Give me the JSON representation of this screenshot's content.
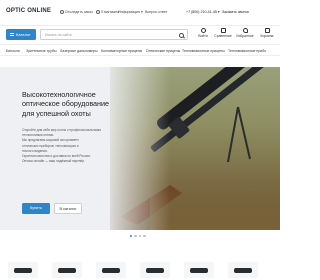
{
  "topbar": {
    "logo": "OPTIC ONLINE",
    "links": [
      {
        "label": "Отследить заказ",
        "icon": "truck-icon"
      },
      {
        "label": "3 магазина",
        "icon": "location-icon"
      },
      {
        "label": "Информация ▾",
        "icon": ""
      },
      {
        "label": "Вопрос-ответ",
        "icon": ""
      }
    ],
    "phone": "+7 (800) 210-41-45 ▾",
    "callback": "Заказать звонок"
  },
  "header": {
    "catalog_label": "Каталог",
    "search_placeholder": "Искать на сайте",
    "items": [
      {
        "label": "Войти",
        "icon": "user-icon"
      },
      {
        "label": "Сравнение",
        "icon": "compare-icon"
      },
      {
        "label": "Избранное",
        "icon": "heart-icon"
      },
      {
        "label": "Корзина",
        "icon": "cart-icon"
      }
    ]
  },
  "nav": {
    "items": [
      "Бинокли",
      "Зрительные трубы",
      "Лазерные дальномеры",
      "Коллиматорные прицелы",
      "Оптические прицелы",
      "Тепловизионные прицелы",
      "Тепловизионные прибо"
    ]
  },
  "hero": {
    "title_lines": [
      "Высокотехнологичное",
      "оптическое оборудование",
      "для успешной охоты"
    ],
    "desc_lines": [
      "Откройте для себя мир охоты с профессиональными",
      "технологиями оптики.",
      "Мы предлагаем широкий ассортимент",
      "оптических приборов, тепловизоров и",
      "ночного видения.",
      "Гарантия качества и доставка по всей России.",
      "Оптика онлайн — ваш надёжный партнёр."
    ],
    "buy_label": "Купить",
    "catalog_label": "В каталог",
    "slides": 4,
    "active_slide": 1
  },
  "colors": {
    "accent": "#2f86c6",
    "hero_bg": "#eef0f3"
  }
}
